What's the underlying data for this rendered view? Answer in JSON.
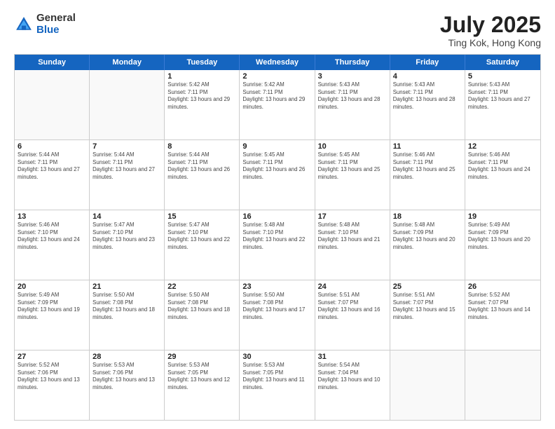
{
  "logo": {
    "general": "General",
    "blue": "Blue"
  },
  "title": "July 2025",
  "location": "Ting Kok, Hong Kong",
  "days_of_week": [
    "Sunday",
    "Monday",
    "Tuesday",
    "Wednesday",
    "Thursday",
    "Friday",
    "Saturday"
  ],
  "weeks": [
    [
      {
        "day": "",
        "empty": true
      },
      {
        "day": "",
        "empty": true
      },
      {
        "day": "1",
        "sunrise": "Sunrise: 5:42 AM",
        "sunset": "Sunset: 7:11 PM",
        "daylight": "Daylight: 13 hours and 29 minutes."
      },
      {
        "day": "2",
        "sunrise": "Sunrise: 5:42 AM",
        "sunset": "Sunset: 7:11 PM",
        "daylight": "Daylight: 13 hours and 29 minutes."
      },
      {
        "day": "3",
        "sunrise": "Sunrise: 5:43 AM",
        "sunset": "Sunset: 7:11 PM",
        "daylight": "Daylight: 13 hours and 28 minutes."
      },
      {
        "day": "4",
        "sunrise": "Sunrise: 5:43 AM",
        "sunset": "Sunset: 7:11 PM",
        "daylight": "Daylight: 13 hours and 28 minutes."
      },
      {
        "day": "5",
        "sunrise": "Sunrise: 5:43 AM",
        "sunset": "Sunset: 7:11 PM",
        "daylight": "Daylight: 13 hours and 27 minutes."
      }
    ],
    [
      {
        "day": "6",
        "sunrise": "Sunrise: 5:44 AM",
        "sunset": "Sunset: 7:11 PM",
        "daylight": "Daylight: 13 hours and 27 minutes."
      },
      {
        "day": "7",
        "sunrise": "Sunrise: 5:44 AM",
        "sunset": "Sunset: 7:11 PM",
        "daylight": "Daylight: 13 hours and 27 minutes."
      },
      {
        "day": "8",
        "sunrise": "Sunrise: 5:44 AM",
        "sunset": "Sunset: 7:11 PM",
        "daylight": "Daylight: 13 hours and 26 minutes."
      },
      {
        "day": "9",
        "sunrise": "Sunrise: 5:45 AM",
        "sunset": "Sunset: 7:11 PM",
        "daylight": "Daylight: 13 hours and 26 minutes."
      },
      {
        "day": "10",
        "sunrise": "Sunrise: 5:45 AM",
        "sunset": "Sunset: 7:11 PM",
        "daylight": "Daylight: 13 hours and 25 minutes."
      },
      {
        "day": "11",
        "sunrise": "Sunrise: 5:46 AM",
        "sunset": "Sunset: 7:11 PM",
        "daylight": "Daylight: 13 hours and 25 minutes."
      },
      {
        "day": "12",
        "sunrise": "Sunrise: 5:46 AM",
        "sunset": "Sunset: 7:11 PM",
        "daylight": "Daylight: 13 hours and 24 minutes."
      }
    ],
    [
      {
        "day": "13",
        "sunrise": "Sunrise: 5:46 AM",
        "sunset": "Sunset: 7:10 PM",
        "daylight": "Daylight: 13 hours and 24 minutes."
      },
      {
        "day": "14",
        "sunrise": "Sunrise: 5:47 AM",
        "sunset": "Sunset: 7:10 PM",
        "daylight": "Daylight: 13 hours and 23 minutes."
      },
      {
        "day": "15",
        "sunrise": "Sunrise: 5:47 AM",
        "sunset": "Sunset: 7:10 PM",
        "daylight": "Daylight: 13 hours and 22 minutes."
      },
      {
        "day": "16",
        "sunrise": "Sunrise: 5:48 AM",
        "sunset": "Sunset: 7:10 PM",
        "daylight": "Daylight: 13 hours and 22 minutes."
      },
      {
        "day": "17",
        "sunrise": "Sunrise: 5:48 AM",
        "sunset": "Sunset: 7:10 PM",
        "daylight": "Daylight: 13 hours and 21 minutes."
      },
      {
        "day": "18",
        "sunrise": "Sunrise: 5:48 AM",
        "sunset": "Sunset: 7:09 PM",
        "daylight": "Daylight: 13 hours and 20 minutes."
      },
      {
        "day": "19",
        "sunrise": "Sunrise: 5:49 AM",
        "sunset": "Sunset: 7:09 PM",
        "daylight": "Daylight: 13 hours and 20 minutes."
      }
    ],
    [
      {
        "day": "20",
        "sunrise": "Sunrise: 5:49 AM",
        "sunset": "Sunset: 7:09 PM",
        "daylight": "Daylight: 13 hours and 19 minutes."
      },
      {
        "day": "21",
        "sunrise": "Sunrise: 5:50 AM",
        "sunset": "Sunset: 7:08 PM",
        "daylight": "Daylight: 13 hours and 18 minutes."
      },
      {
        "day": "22",
        "sunrise": "Sunrise: 5:50 AM",
        "sunset": "Sunset: 7:08 PM",
        "daylight": "Daylight: 13 hours and 18 minutes."
      },
      {
        "day": "23",
        "sunrise": "Sunrise: 5:50 AM",
        "sunset": "Sunset: 7:08 PM",
        "daylight": "Daylight: 13 hours and 17 minutes."
      },
      {
        "day": "24",
        "sunrise": "Sunrise: 5:51 AM",
        "sunset": "Sunset: 7:07 PM",
        "daylight": "Daylight: 13 hours and 16 minutes."
      },
      {
        "day": "25",
        "sunrise": "Sunrise: 5:51 AM",
        "sunset": "Sunset: 7:07 PM",
        "daylight": "Daylight: 13 hours and 15 minutes."
      },
      {
        "day": "26",
        "sunrise": "Sunrise: 5:52 AM",
        "sunset": "Sunset: 7:07 PM",
        "daylight": "Daylight: 13 hours and 14 minutes."
      }
    ],
    [
      {
        "day": "27",
        "sunrise": "Sunrise: 5:52 AM",
        "sunset": "Sunset: 7:06 PM",
        "daylight": "Daylight: 13 hours and 13 minutes."
      },
      {
        "day": "28",
        "sunrise": "Sunrise: 5:53 AM",
        "sunset": "Sunset: 7:06 PM",
        "daylight": "Daylight: 13 hours and 13 minutes."
      },
      {
        "day": "29",
        "sunrise": "Sunrise: 5:53 AM",
        "sunset": "Sunset: 7:05 PM",
        "daylight": "Daylight: 13 hours and 12 minutes."
      },
      {
        "day": "30",
        "sunrise": "Sunrise: 5:53 AM",
        "sunset": "Sunset: 7:05 PM",
        "daylight": "Daylight: 13 hours and 11 minutes."
      },
      {
        "day": "31",
        "sunrise": "Sunrise: 5:54 AM",
        "sunset": "Sunset: 7:04 PM",
        "daylight": "Daylight: 13 hours and 10 minutes."
      },
      {
        "day": "",
        "empty": true
      },
      {
        "day": "",
        "empty": true
      }
    ]
  ]
}
